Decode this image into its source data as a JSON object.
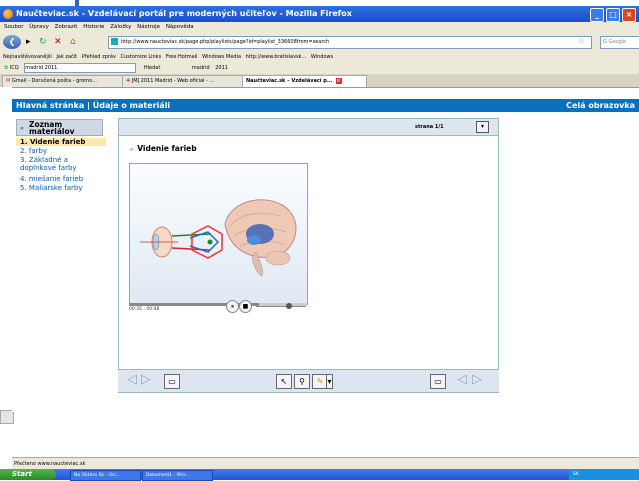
{
  "window": {
    "title": "Naučteviac.sk - Vzdelávací portál pre moderných učiteľov - Mozilla Firefox"
  },
  "menu": [
    "Soubor",
    "Úpravy",
    "Zobrazit",
    "Historie",
    "Záložky",
    "Nástroje",
    "Nápověda"
  ],
  "nav": {
    "url": "http://www.naucteviac.sk/page.php/playlists/page?id=playlist_336608from=search",
    "search_placeholder": "Google"
  },
  "bookmarks": [
    "Nejnavštěvovanější",
    "Jak začít",
    "Přehled zpráv",
    "Customize Links",
    "Free Hotmail",
    "Windows Media",
    "http://www.bratislavsk...",
    "Windows"
  ],
  "toolbar2": {
    "icq": "ICQ",
    "search_value": "madrid 2011",
    "hledat": "Hledat",
    "madrid": "madrid",
    "year": "2011"
  },
  "tabs": [
    {
      "label": "Gmail - Doručená pošta - gromo..."
    },
    {
      "label": "JMJ 2011 Madrid - Web oficial - ..."
    },
    {
      "label": "Naučteviac.sk – Vzdelávací p..."
    }
  ],
  "site": {
    "breadcrumb": "Hlavná stránka | Údaje o materiáli",
    "fullscreen": "Celá obrazovka"
  },
  "sidebar": {
    "heading": "Zoznam materiálov",
    "items": [
      {
        "label": "1. Videnie farieb"
      },
      {
        "label": "2. farby"
      },
      {
        "label": "3. Základné a doplnkové farby"
      },
      {
        "label": "4. miešanie farieb"
      },
      {
        "label": "5. Maliarske farby"
      }
    ]
  },
  "viewer": {
    "page_indicator": "strana 1/1",
    "video_title": "Videnie farieb",
    "time": "00:35 : 00:48",
    "progress": 0.73
  },
  "status": {
    "text": "Přečteno www.naucteviac.sk"
  },
  "taskbar": {
    "start": "Start",
    "items": [
      "Na Oktávs Sk - Ucí...",
      "Dokument1 - Micr..."
    ],
    "tray": "SK"
  },
  "colors": {
    "title_bar": "#1f5fd6",
    "site_header": "#0a70b9",
    "selected_item": "#ffe9a8",
    "link": "#0a5ea8"
  }
}
